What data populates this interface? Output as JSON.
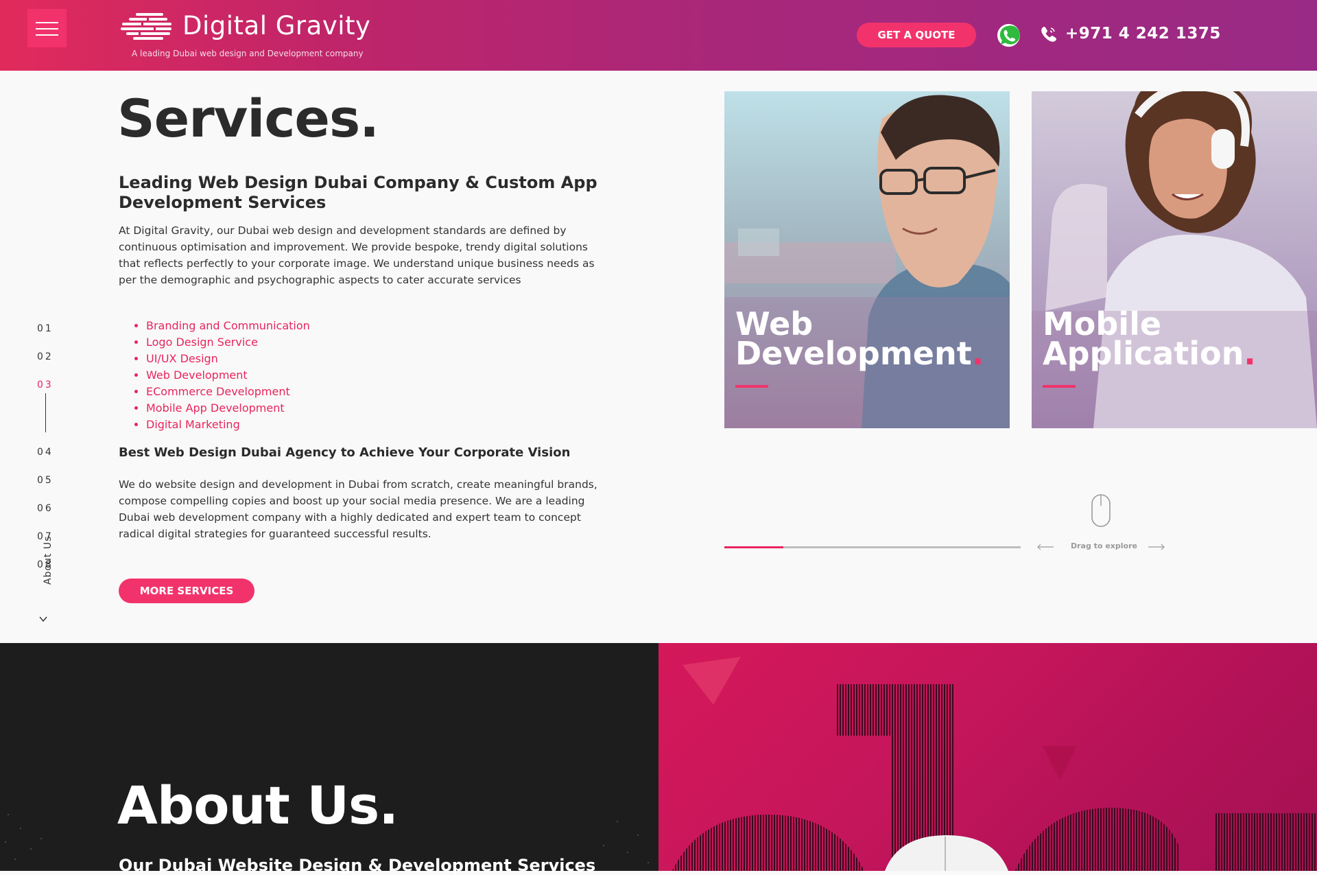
{
  "header": {
    "brand_name": "Digital Gravity",
    "tagline": "A leading Dubai web design and Development company",
    "quote_button": "GET A QUOTE",
    "phone": "+971 4 242 1375"
  },
  "side_nav": {
    "items": [
      "01",
      "02",
      "03",
      "04",
      "05",
      "06",
      "07",
      "08"
    ],
    "active": "03",
    "section_label": "About Us"
  },
  "services": {
    "title": "Services.",
    "heading": "Leading Web Design Dubai Company & Custom App Development Services",
    "intro": "At Digital Gravity, our Dubai web design and development standards are defined by continuous optimisation and improvement. We provide bespoke, trendy digital solutions that reflects perfectly to your corporate image. We understand unique business needs as per the demographic and psychographic aspects to cater accurate services",
    "links": [
      "Branding and Communication",
      "Logo Design Service",
      "UI/UX Design",
      "Web Development",
      "ECommerce Development",
      "Mobile App Development",
      "Digital Marketing"
    ],
    "subheading": "Best Web Design Dubai Agency to Achieve Your Corporate Vision",
    "body": "We do website design and development in Dubai from scratch, create meaningful brands, compose compelling copies and boost up your social media presence. We are a leading Dubai web development company with a highly dedicated and expert team to concept radical digital strategies for guaranteed successful results.",
    "more_button": "MORE SERVICES"
  },
  "carousel": {
    "cards": [
      {
        "line1": "Web",
        "line2": "Development",
        "dot": "."
      },
      {
        "line1": "Mobile",
        "line2": "Application",
        "dot": "."
      }
    ],
    "drag_label": "Drag to explore",
    "progress_fraction": 0.2
  },
  "about": {
    "title": "About Us.",
    "subtitle": "Our Dubai Website Design & Development Services"
  },
  "colors": {
    "accent": "#f2336b",
    "header_gradient_start": "#e12a5c",
    "header_gradient_end": "#992a85",
    "dark_section": "#1d1d1d"
  }
}
